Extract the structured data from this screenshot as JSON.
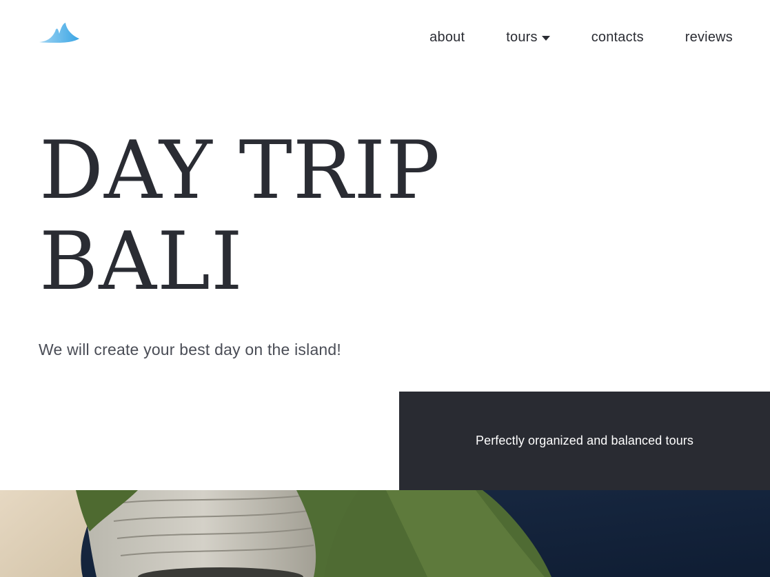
{
  "brand": {
    "logo_icon": "manta-ray-logo-icon",
    "logo_color_light": "#9fd4f3",
    "logo_color_dark": "#3aa5e4"
  },
  "nav": {
    "items": [
      {
        "label": "about"
      },
      {
        "label": "tours",
        "has_dropdown": true,
        "icon": "caret-down-icon"
      },
      {
        "label": "contacts"
      },
      {
        "label": "reviews"
      }
    ]
  },
  "hero": {
    "title_line1": "DAY TRIP",
    "title_line2": "BALI",
    "subtitle": "We will create your best day on the island!"
  },
  "tagline": {
    "text": "Perfectly organized and balanced tours",
    "background": "#292b32"
  },
  "photo": {
    "subject": "aerial-coastline-cliff-image"
  },
  "colors": {
    "text_primary": "#2a2c33",
    "page_background": "#ffffff"
  }
}
